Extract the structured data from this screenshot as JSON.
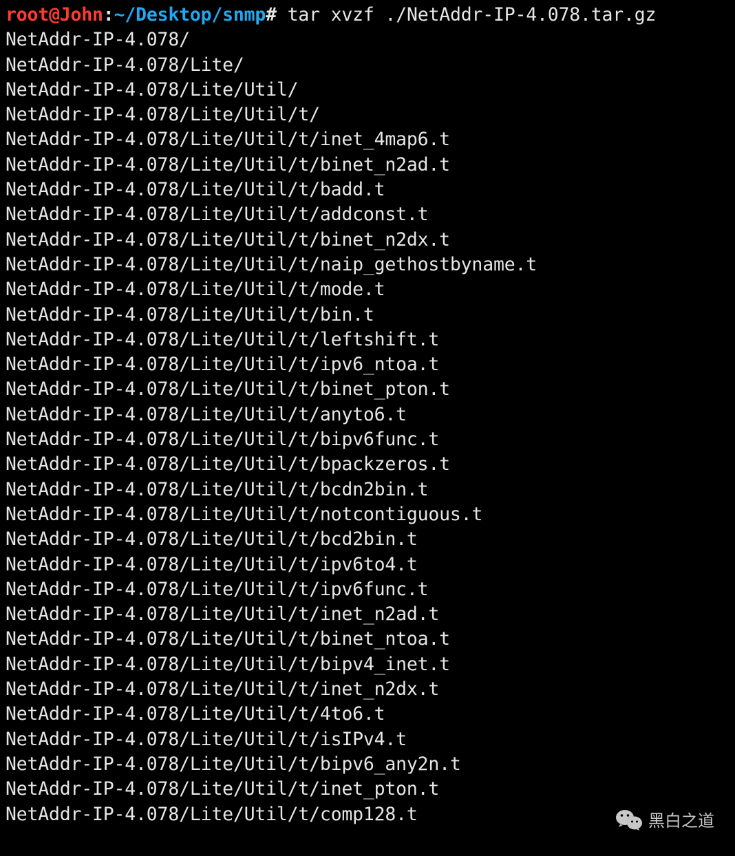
{
  "prompt": {
    "user_host": "root@John",
    "colon": ":",
    "path": "~/Desktop/snmp",
    "hash": "#",
    "command": " tar xvzf ./NetAddr-IP-4.078.tar.gz"
  },
  "lines": [
    "NetAddr-IP-4.078/",
    "NetAddr-IP-4.078/Lite/",
    "NetAddr-IP-4.078/Lite/Util/",
    "NetAddr-IP-4.078/Lite/Util/t/",
    "NetAddr-IP-4.078/Lite/Util/t/inet_4map6.t",
    "NetAddr-IP-4.078/Lite/Util/t/binet_n2ad.t",
    "NetAddr-IP-4.078/Lite/Util/t/badd.t",
    "NetAddr-IP-4.078/Lite/Util/t/addconst.t",
    "NetAddr-IP-4.078/Lite/Util/t/binet_n2dx.t",
    "NetAddr-IP-4.078/Lite/Util/t/naip_gethostbyname.t",
    "NetAddr-IP-4.078/Lite/Util/t/mode.t",
    "NetAddr-IP-4.078/Lite/Util/t/bin.t",
    "NetAddr-IP-4.078/Lite/Util/t/leftshift.t",
    "NetAddr-IP-4.078/Lite/Util/t/ipv6_ntoa.t",
    "NetAddr-IP-4.078/Lite/Util/t/binet_pton.t",
    "NetAddr-IP-4.078/Lite/Util/t/anyto6.t",
    "NetAddr-IP-4.078/Lite/Util/t/bipv6func.t",
    "NetAddr-IP-4.078/Lite/Util/t/bpackzeros.t",
    "NetAddr-IP-4.078/Lite/Util/t/bcdn2bin.t",
    "NetAddr-IP-4.078/Lite/Util/t/notcontiguous.t",
    "NetAddr-IP-4.078/Lite/Util/t/bcd2bin.t",
    "NetAddr-IP-4.078/Lite/Util/t/ipv6to4.t",
    "NetAddr-IP-4.078/Lite/Util/t/ipv6func.t",
    "NetAddr-IP-4.078/Lite/Util/t/inet_n2ad.t",
    "NetAddr-IP-4.078/Lite/Util/t/binet_ntoa.t",
    "NetAddr-IP-4.078/Lite/Util/t/bipv4_inet.t",
    "NetAddr-IP-4.078/Lite/Util/t/inet_n2dx.t",
    "NetAddr-IP-4.078/Lite/Util/t/4to6.t",
    "NetAddr-IP-4.078/Lite/Util/t/isIPv4.t",
    "NetAddr-IP-4.078/Lite/Util/t/bipv6_any2n.t",
    "NetAddr-IP-4.078/Lite/Util/t/inet_pton.t",
    "NetAddr-IP-4.078/Lite/Util/t/comp128.t"
  ],
  "watermark": {
    "text": "黑白之道"
  }
}
